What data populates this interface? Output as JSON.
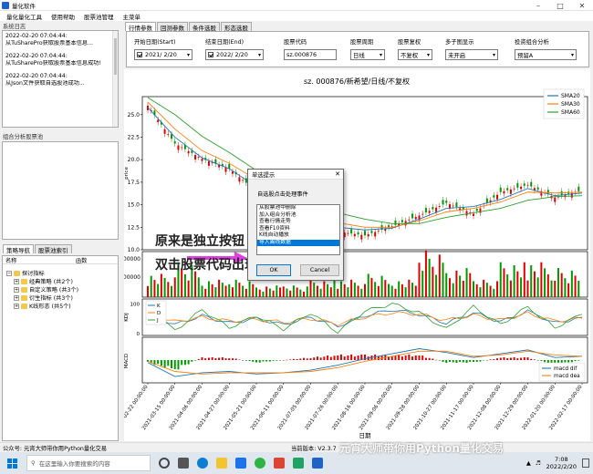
{
  "window": {
    "title": "量化软件"
  },
  "menu": [
    "量化量化工具",
    "使用帮助",
    "股票池管理",
    "主菜单"
  ],
  "left": {
    "log_title": "系统日志",
    "log_lines": [
      {
        "ts": "2022-02-20 07:04:44:",
        "msg": "从TuSharePro获取股票基本信息..."
      },
      {
        "ts": "2022-02-20 07:04:44:",
        "msg": "从TuSharePro获取股票基本信息成功!"
      },
      {
        "ts": "2022-02-20 07:04:44:",
        "msg": "从Json文件获取自选股池成功..."
      }
    ],
    "analysis_title": "组合分析股票池",
    "nav_tabs": [
      "策略导航",
      "股票池索引"
    ],
    "tree_headers": [
      "名称",
      "函数"
    ],
    "tree": [
      {
        "label": "探讨指标",
        "level": 0
      },
      {
        "label": "经典策略 (共2个)",
        "level": 1
      },
      {
        "label": "自定义策略 (共3个)",
        "level": 1
      },
      {
        "label": "衍生指标 (共3个)",
        "level": 1
      },
      {
        "label": "K线形态 (共5个)",
        "level": 1
      }
    ]
  },
  "tabs": [
    "行情参数",
    "回测参数",
    "条件选股",
    "形态选股"
  ],
  "params": {
    "start_label": "开始日期(Start)",
    "start_value": "2021/ 2/20",
    "end_label": "结束日期(End)",
    "end_value": "2022/ 2/20",
    "code_label": "股票代码",
    "code_value": "sz.000876",
    "period_label": "股票周期",
    "period_value": "日线",
    "adjust_label": "股票复权",
    "adjust_value": "不复权",
    "multi_label": "多子图显示",
    "multi_value": "未开启",
    "analysis_label": "投资组合分析",
    "analysis_value": "预留A"
  },
  "chart_data": {
    "type": "line",
    "title": "sz. 000876/新希望/日线/不复权",
    "xlabel": "日期",
    "x": [
      "2021-02-22",
      "2021-03-15",
      "2021-04-06",
      "2021-04-27",
      "2021-05-21",
      "2021-06-11",
      "2021-07-05",
      "2021-07-26",
      "2021-08-16",
      "2021-09-06",
      "2021-09-28",
      "2021-10-27",
      "2021-11-17",
      "2021-12-08",
      "2021-12-29",
      "2022-01-20",
      "2022-02-17"
    ],
    "x_tick_suffix": " 00:00:00",
    "price": {
      "ylim": [
        10,
        27
      ],
      "yticks": [
        10.0,
        12.5,
        15.0,
        17.5,
        20.0,
        22.5,
        25.0
      ],
      "ylabel": "price",
      "series": [
        {
          "name": "SMA20",
          "color": "#1f77b4",
          "values": [
            25.8,
            22.5,
            20.2,
            19.0,
            17.0,
            15.0,
            13.3,
            12.5,
            12.2,
            12.4,
            13.4,
            14.6,
            14.8,
            15.6,
            16.8,
            16.0,
            16.3
          ]
        },
        {
          "name": "SMA30",
          "color": "#ff7f0e",
          "values": [
            26.4,
            23.4,
            21.0,
            19.6,
            17.8,
            15.8,
            13.9,
            13.0,
            12.5,
            12.5,
            13.2,
            14.2,
            14.6,
            15.3,
            16.4,
            16.3,
            16.4
          ]
        },
        {
          "name": "SMA60",
          "color": "#2ca02c",
          "values": [
            26.9,
            25.0,
            22.6,
            20.8,
            18.8,
            17.0,
            15.2,
            14.1,
            13.4,
            12.9,
            12.9,
            13.6,
            14.1,
            14.6,
            15.5,
            15.9,
            16.0
          ]
        }
      ],
      "close": [
        26.0,
        21.8,
        20.1,
        19.0,
        16.5,
        14.2,
        12.8,
        12.0,
        11.6,
        12.6,
        13.8,
        15.2,
        14.0,
        16.4,
        17.2,
        15.8,
        16.6
      ]
    },
    "volume": {
      "ylabel": "Volume",
      "ytick_labels": [
        "000000",
        "000000"
      ],
      "values": [
        4,
        6,
        3,
        3,
        2,
        2,
        3,
        3,
        4,
        3,
        8,
        5,
        3,
        6,
        6,
        5,
        4
      ],
      "up": [
        1,
        0,
        0,
        1,
        0,
        0,
        1,
        0,
        1,
        1,
        1,
        1,
        0,
        1,
        1,
        0,
        1
      ]
    },
    "kdj": {
      "ylabel": "KDJ",
      "yticks": [
        0,
        20,
        40,
        60,
        80,
        100
      ],
      "series": [
        {
          "name": "K",
          "color": "#1f77b4",
          "values": [
            70,
            30,
            60,
            35,
            50,
            30,
            55,
            25,
            60,
            80,
            65,
            35,
            70,
            40,
            75,
            35,
            55
          ]
        },
        {
          "name": "D",
          "color": "#ff7f0e",
          "values": [
            65,
            40,
            55,
            42,
            48,
            38,
            50,
            32,
            55,
            70,
            65,
            45,
            62,
            45,
            68,
            42,
            52
          ]
        },
        {
          "name": "J",
          "color": "#2ca02c",
          "values": [
            85,
            10,
            80,
            20,
            60,
            15,
            70,
            5,
            75,
            100,
            70,
            15,
            90,
            30,
            90,
            20,
            65
          ]
        }
      ]
    },
    "macd": {
      "ylabel": "MACD",
      "series": [
        {
          "name": "macd dif",
          "color": "#1f77b4",
          "values": [
            -0.2,
            -1.3,
            -1.0,
            -0.9,
            -1.1,
            -1.0,
            -0.8,
            -0.4,
            0.1,
            0.5,
            0.9,
            0.6,
            0.2,
            0.5,
            0.8,
            0.2,
            0.3
          ]
        },
        {
          "name": "macd dea",
          "color": "#ff7f0e",
          "values": [
            -0.1,
            -0.9,
            -1.1,
            -1.0,
            -1.0,
            -1.0,
            -0.9,
            -0.6,
            -0.1,
            0.3,
            0.7,
            0.7,
            0.3,
            0.4,
            0.7,
            0.4,
            0.3
          ]
        }
      ],
      "hist": [
        -0.2,
        -0.8,
        0.2,
        0.2,
        -0.2,
        0.0,
        0.2,
        0.4,
        0.4,
        0.4,
        0.4,
        -0.2,
        -0.2,
        0.2,
        0.2,
        -0.4,
        0.0
      ]
    }
  },
  "dialog": {
    "title": "单选提示",
    "message": "自选股点击处理事件",
    "items": [
      "从股票池中删除",
      "加入组合分析池",
      "查看行情走势",
      "查看F10资料",
      "K线自动播放",
      "导入离线数据"
    ],
    "selected": 5,
    "ok": "OK",
    "cancel": "Cancel"
  },
  "annotations": {
    "top": "原来是独立按钮",
    "bottom": "双击股票代码出现"
  },
  "status": {
    "left": "公众号: 元宵大师带你用Python量化交易",
    "version": "当前版本: V2.3.7"
  },
  "taskbar": {
    "search_placeholder": "在这里输入你要搜索的内容",
    "time": "7:08",
    "date": "2022/2/20"
  },
  "watermark": "元宵大师带你用Python量化交易",
  "colors": {
    "up": "#e00000",
    "down": "#009900",
    "selection": "#0078d7"
  }
}
